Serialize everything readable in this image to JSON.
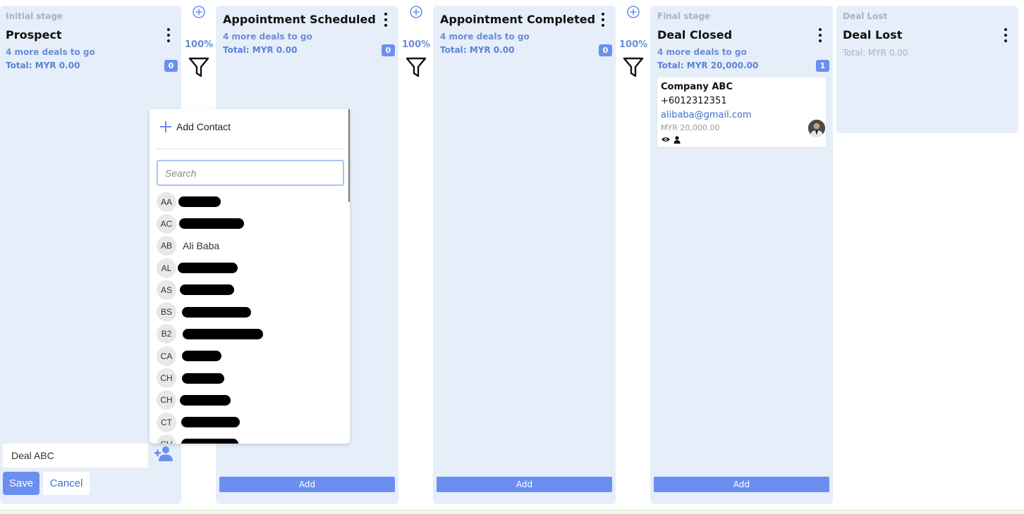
{
  "columns": [
    {
      "stage_label": "Initial stage",
      "title": "Prospect",
      "more_deals": "4 more deals to go",
      "total": "Total: MYR 0.00",
      "count": "0"
    },
    {
      "stage_label": "",
      "title": "Appointment Scheduled",
      "more_deals": "4 more deals to go",
      "total": "Total: MYR 0.00",
      "count": "0",
      "add_label": "Add"
    },
    {
      "stage_label": "",
      "title": "Appointment Completed",
      "more_deals": "4 more deals to go",
      "total": "Total: MYR 0.00",
      "count": "0",
      "add_label": "Add"
    },
    {
      "stage_label": "Final stage",
      "title": "Deal Closed",
      "more_deals": "4 more deals to go",
      "total": "Total: MYR 20,000.00",
      "count": "1",
      "add_label": "Add"
    },
    {
      "stage_label": "Deal Lost",
      "title": "Deal Lost",
      "total": "Total: MYR 0.00"
    }
  ],
  "conversion_rates": [
    "100%",
    "100%",
    "100%"
  ],
  "deal_card": {
    "company": "Company ABC",
    "phone": "+6012312351",
    "email": "alibaba@gmail.com",
    "value": "MYR 20,000.00"
  },
  "new_deal": {
    "name_value": "Deal ABC",
    "save_label": "Save",
    "cancel_label": "Cancel"
  },
  "contact_picker": {
    "add_contact_label": "Add Contact",
    "search_placeholder": "Search",
    "contacts": [
      {
        "initials": "AA",
        "name": ""
      },
      {
        "initials": "AC",
        "name": ""
      },
      {
        "initials": "AB",
        "name": "Ali Baba"
      },
      {
        "initials": "AL",
        "name": ""
      },
      {
        "initials": "AS",
        "name": ""
      },
      {
        "initials": "BS",
        "name": ""
      },
      {
        "initials": "B2",
        "name": ""
      },
      {
        "initials": "CA",
        "name": ""
      },
      {
        "initials": "CH",
        "name": ""
      },
      {
        "initials": "CH",
        "name": ""
      },
      {
        "initials": "CT",
        "name": ""
      },
      {
        "initials": "CH",
        "name": ""
      }
    ]
  },
  "icons": {
    "kebab": "more-vertical-icon",
    "plus": "plus-circle-icon",
    "funnel": "funnel-icon",
    "assign": "add-person-icon",
    "view": "eye-icon",
    "owner": "person-icon"
  },
  "colors": {
    "accent": "#6b8ff0",
    "column_bg": "#e6eef9",
    "link": "#3a72c9",
    "muted": "#a9b2bf"
  }
}
